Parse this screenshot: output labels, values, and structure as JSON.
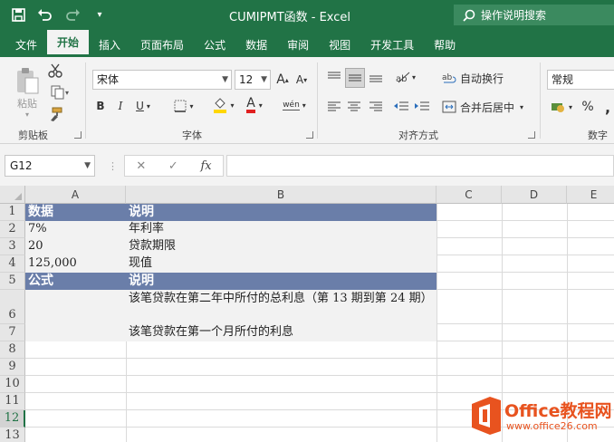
{
  "window": {
    "title": "CUMIPMT函数 - Excel",
    "tell_me": "操作说明搜索"
  },
  "quick_access": {
    "save": "save-icon",
    "undo": "undo-icon",
    "redo": "redo-icon",
    "customize": "▾"
  },
  "tabs": [
    {
      "label": "文件",
      "active": false
    },
    {
      "label": "开始",
      "active": true
    },
    {
      "label": "插入",
      "active": false
    },
    {
      "label": "页面布局",
      "active": false
    },
    {
      "label": "公式",
      "active": false
    },
    {
      "label": "数据",
      "active": false
    },
    {
      "label": "审阅",
      "active": false
    },
    {
      "label": "视图",
      "active": false
    },
    {
      "label": "开发工具",
      "active": false
    },
    {
      "label": "帮助",
      "active": false
    }
  ],
  "ribbon": {
    "clipboard": {
      "label": "剪贴板",
      "paste": "粘贴"
    },
    "font": {
      "label": "字体",
      "name": "宋体",
      "size": "12",
      "bold": "B",
      "italic": "I",
      "underline": "U",
      "phonetic": "wén"
    },
    "alignment": {
      "label": "对齐方式",
      "wrap": "自动换行",
      "merge": "合并后居中"
    },
    "number": {
      "label": "数字",
      "format": "常规",
      "percent": "%",
      "comma": ","
    }
  },
  "formula_bar": {
    "name_box": "G12",
    "cancel": "✕",
    "enter": "✓",
    "fx": "fx",
    "value": ""
  },
  "columns": [
    "A",
    "B",
    "C",
    "D",
    "E"
  ],
  "rows": [
    "1",
    "2",
    "3",
    "4",
    "5",
    "6",
    "7",
    "8",
    "9",
    "10",
    "11",
    "12",
    "13"
  ],
  "selected_row": "12",
  "cells": {
    "a1": "数据",
    "b1": "说明",
    "a2": "7%",
    "b2": "年利率",
    "a3": "20",
    "b3": "贷款期限",
    "a4": "125,000",
    "b4": "现值",
    "a5": "公式",
    "b5": "说明",
    "b6": "该笔贷款在第二年中所付的总利息（第 13 期到第 24 期）",
    "b7": "该笔贷款在第一个月所付的利息"
  },
  "watermark": {
    "brand": "Office教程网",
    "url": "www.office26.com"
  },
  "colors": {
    "excel_green": "#217346",
    "header_band": "#6a7ea9",
    "watermark_orange": "#e8531f"
  }
}
